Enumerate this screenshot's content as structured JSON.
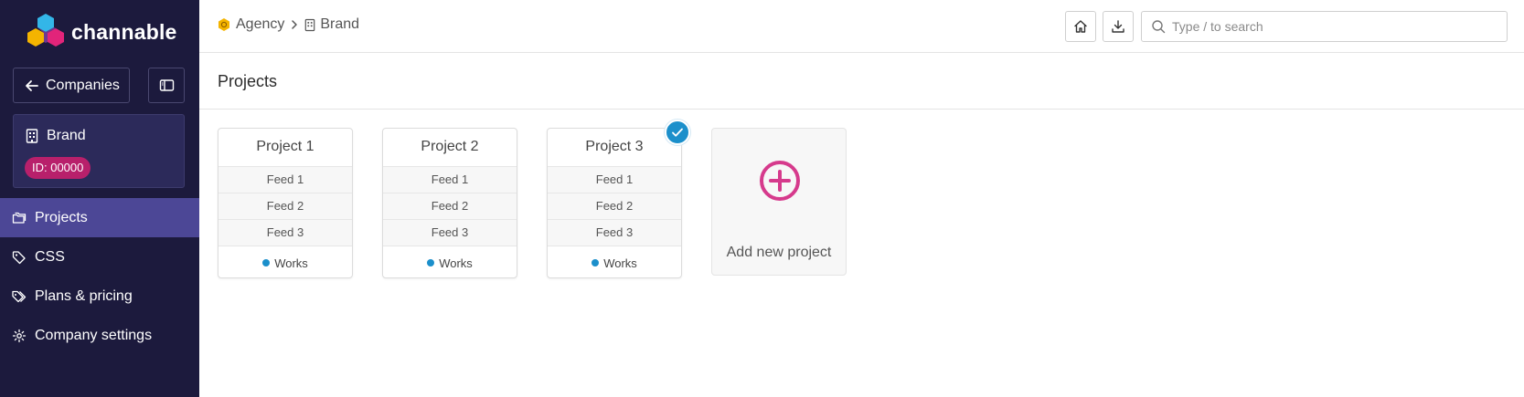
{
  "app": {
    "logo_text": "channable"
  },
  "sidebar": {
    "companies_button": "Companies",
    "brand_card": {
      "name": "Brand",
      "id_badge": "ID: 00000"
    },
    "nav": [
      {
        "label": "Projects",
        "icon": "folders-icon",
        "active": true
      },
      {
        "label": "CSS",
        "icon": "tag-icon",
        "active": false
      },
      {
        "label": "Plans & pricing",
        "icon": "tags-icon",
        "active": false
      },
      {
        "label": "Company settings",
        "icon": "gear-icon",
        "active": false
      }
    ]
  },
  "header": {
    "breadcrumb": [
      {
        "label": "Agency",
        "icon": "agency-hexagon-icon"
      },
      {
        "label": "Brand",
        "icon": "building-icon"
      }
    ],
    "search_placeholder": "Type / to search"
  },
  "main": {
    "title": "Projects",
    "projects": [
      {
        "name": "Project 1",
        "feeds": [
          "Feed 1",
          "Feed 2",
          "Feed 3"
        ],
        "status": "Works",
        "selected": false
      },
      {
        "name": "Project 2",
        "feeds": [
          "Feed 1",
          "Feed 2",
          "Feed 3"
        ],
        "status": "Works",
        "selected": false
      },
      {
        "name": "Project 3",
        "feeds": [
          "Feed 1",
          "Feed 2",
          "Feed 3"
        ],
        "status": "Works",
        "selected": true
      }
    ],
    "add_project_label": "Add new project"
  },
  "colors": {
    "sidebar_bg": "#1c1a3d",
    "nav_active": "#4c4796",
    "brand_badge": "#b8206b",
    "status_dot": "#1b8fcb",
    "add_icon": "#d63a8c"
  }
}
